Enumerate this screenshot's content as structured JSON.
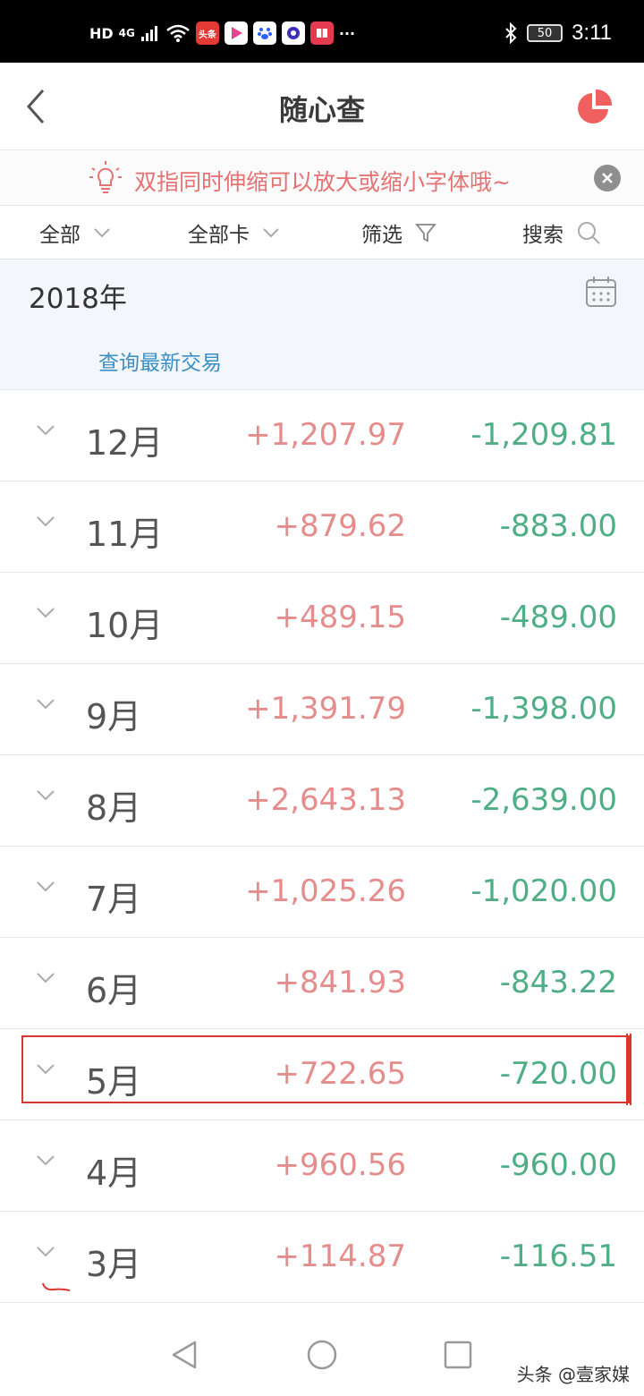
{
  "status_bar": {
    "network_label": "HD",
    "signal_label": "4G",
    "app_icons": [
      "头条",
      "video-app",
      "baidu-paw",
      "circle-app",
      "book-app"
    ],
    "more": "···",
    "battery": "50",
    "time": "3:11"
  },
  "header": {
    "title": "随心查"
  },
  "tip": {
    "text": "双指同时伸缩可以放大或缩小字体哦~"
  },
  "filters": {
    "all": "全部",
    "all_cards": "全部卡",
    "filter": "筛选",
    "search": "搜索"
  },
  "year_section": {
    "year": "2018年",
    "latest_link": "查询最新交易"
  },
  "months": [
    {
      "month": "12月",
      "income": "+1,207.97",
      "expense": "-1,209.81"
    },
    {
      "month": "11月",
      "income": "+879.62",
      "expense": "-883.00"
    },
    {
      "month": "10月",
      "income": "+489.15",
      "expense": "-489.00"
    },
    {
      "month": "9月",
      "income": "+1,391.79",
      "expense": "-1,398.00"
    },
    {
      "month": "8月",
      "income": "+2,643.13",
      "expense": "-2,639.00"
    },
    {
      "month": "7月",
      "income": "+1,025.26",
      "expense": "-1,020.00"
    },
    {
      "month": "6月",
      "income": "+841.93",
      "expense": "-843.22"
    },
    {
      "month": "5月",
      "income": "+722.65",
      "expense": "-720.00"
    },
    {
      "month": "4月",
      "income": "+960.56",
      "expense": "-960.00"
    },
    {
      "month": "3月",
      "income": "+114.87",
      "expense": "-116.51"
    }
  ],
  "watermark": "头条 @壹家媒",
  "colors": {
    "income": "#e58c8c",
    "expense": "#4fae85",
    "accent": "#f06060",
    "link": "#3a8fc7",
    "highlight": "#d9372f"
  }
}
